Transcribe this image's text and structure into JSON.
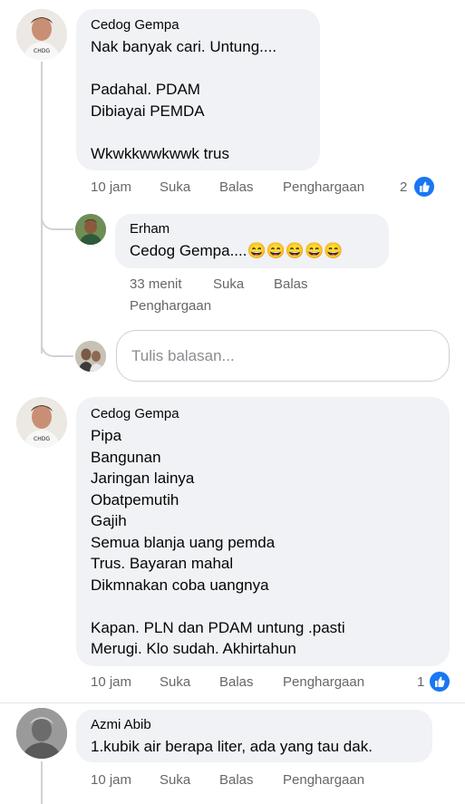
{
  "comments": [
    {
      "author": "Cedog Gempa",
      "text": "Nak banyak cari. Untung....\n\nPadahal. PDAM\nDibiayai PEMDA\n\nWkwkkwwkwwk trus",
      "time": "10 jam",
      "like": "Suka",
      "reply": "Balas",
      "award": "Penghargaan",
      "reaction_count": "2"
    },
    {
      "author": "Erham",
      "text": "Cedog Gempa....😄😄😄😄😄",
      "time": "33 menit",
      "like": "Suka",
      "reply": "Balas",
      "award": "Penghargaan"
    },
    {
      "author": "Cedog Gempa",
      "text": "Pipa\nBangunan\nJaringan lainya\nObatpemutih\nGajih\nSemua blanja uang pemda\nTrus. Bayaran mahal\nDikmnakan coba uangnya\n\nKapan. PLN dan PDAM untung .pasti\nMerugi. Klo sudah. Akhirtahun",
      "time": "10 jam",
      "like": "Suka",
      "reply": "Balas",
      "award": "Penghargaan",
      "reaction_count": "1"
    },
    {
      "author": "Azmi Abib",
      "text": "1.kubik air berapa liter, ada yang tau dak.",
      "time": "10 jam",
      "like": "Suka",
      "reply": "Balas",
      "award": "Penghargaan"
    }
  ],
  "reply_box": {
    "placeholder": "Tulis balasan..."
  },
  "colors": {
    "bubble": "#f0f2f5",
    "meta": "#65676b",
    "like_blue": "#1877f2"
  }
}
